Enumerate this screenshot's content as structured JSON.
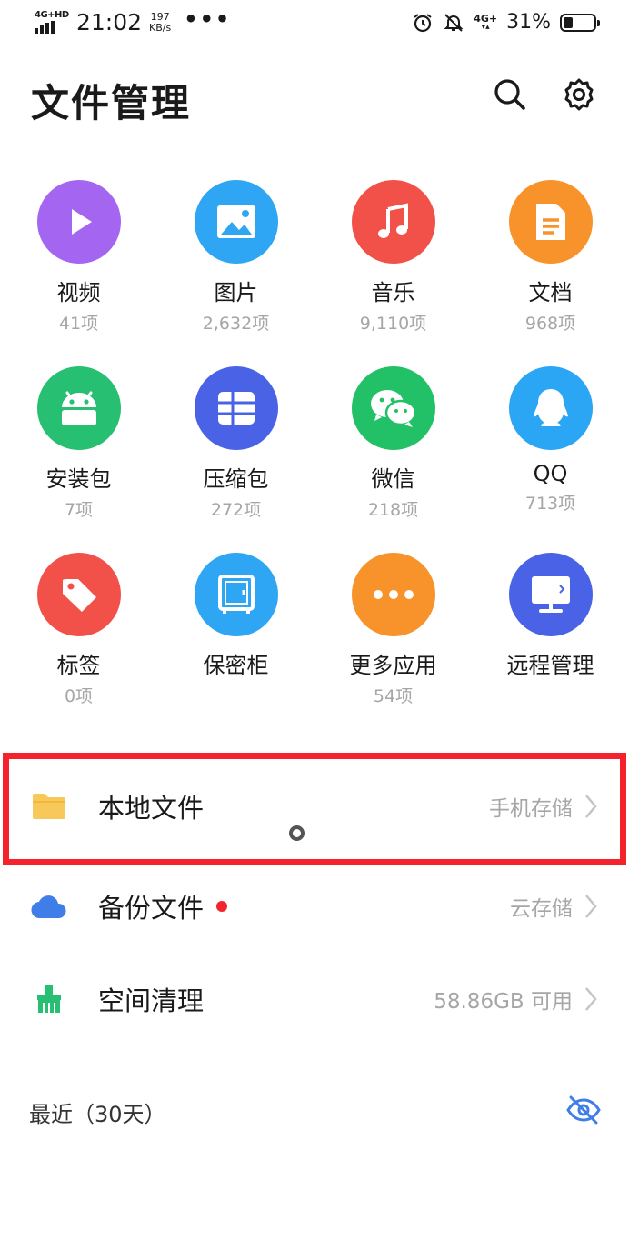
{
  "status": {
    "network_left": "4G+HD",
    "time": "21:02",
    "speed_value": "197",
    "speed_unit": "KB/s",
    "more": "•••",
    "network_right": "4G+",
    "battery_percent": "31%",
    "battery_level": 0.31
  },
  "header": {
    "title": "文件管理",
    "icons": [
      "search-icon",
      "gear-icon"
    ]
  },
  "categories": [
    {
      "label": "视频",
      "count": "41项",
      "color": "#a466f0",
      "icon": "play-icon"
    },
    {
      "label": "图片",
      "count": "2,632项",
      "color": "#2ea6f3",
      "icon": "image-icon"
    },
    {
      "label": "音乐",
      "count": "9,110项",
      "color": "#f2514a",
      "icon": "music-icon"
    },
    {
      "label": "文档",
      "count": "968项",
      "color": "#f7932a",
      "icon": "document-icon"
    },
    {
      "label": "安装包",
      "count": "7项",
      "color": "#27c073",
      "icon": "android-icon"
    },
    {
      "label": "压缩包",
      "count": "272项",
      "color": "#4a62e6",
      "icon": "archive-icon"
    },
    {
      "label": "微信",
      "count": "218项",
      "color": "#22c067",
      "icon": "wechat-icon"
    },
    {
      "label": "QQ",
      "count": "713项",
      "color": "#2ba6f5",
      "icon": "qq-icon"
    },
    {
      "label": "标签",
      "count": "0项",
      "color": "#f2514a",
      "icon": "tag-icon"
    },
    {
      "label": "保密柜",
      "count": "",
      "color": "#2ea6f3",
      "icon": "safe-icon"
    },
    {
      "label": "更多应用",
      "count": "54项",
      "color": "#f7932a",
      "icon": "more-apps-icon"
    },
    {
      "label": "远程管理",
      "count": "",
      "color": "#4a62e6",
      "icon": "monitor-icon"
    }
  ],
  "list": [
    {
      "name": "本地文件",
      "sub": "手机存储",
      "icon": "folder-icon",
      "color": "#f7c85a"
    },
    {
      "name": "备份文件",
      "sub": "云存储",
      "icon": "cloud-icon",
      "color": "#3f7de8"
    },
    {
      "name": "空间清理",
      "sub": "58.86GB 可用",
      "icon": "broom-icon",
      "color": "#27c073"
    }
  ],
  "recent": {
    "label": "最近（30天）",
    "icon": "eye-hidden-icon"
  }
}
